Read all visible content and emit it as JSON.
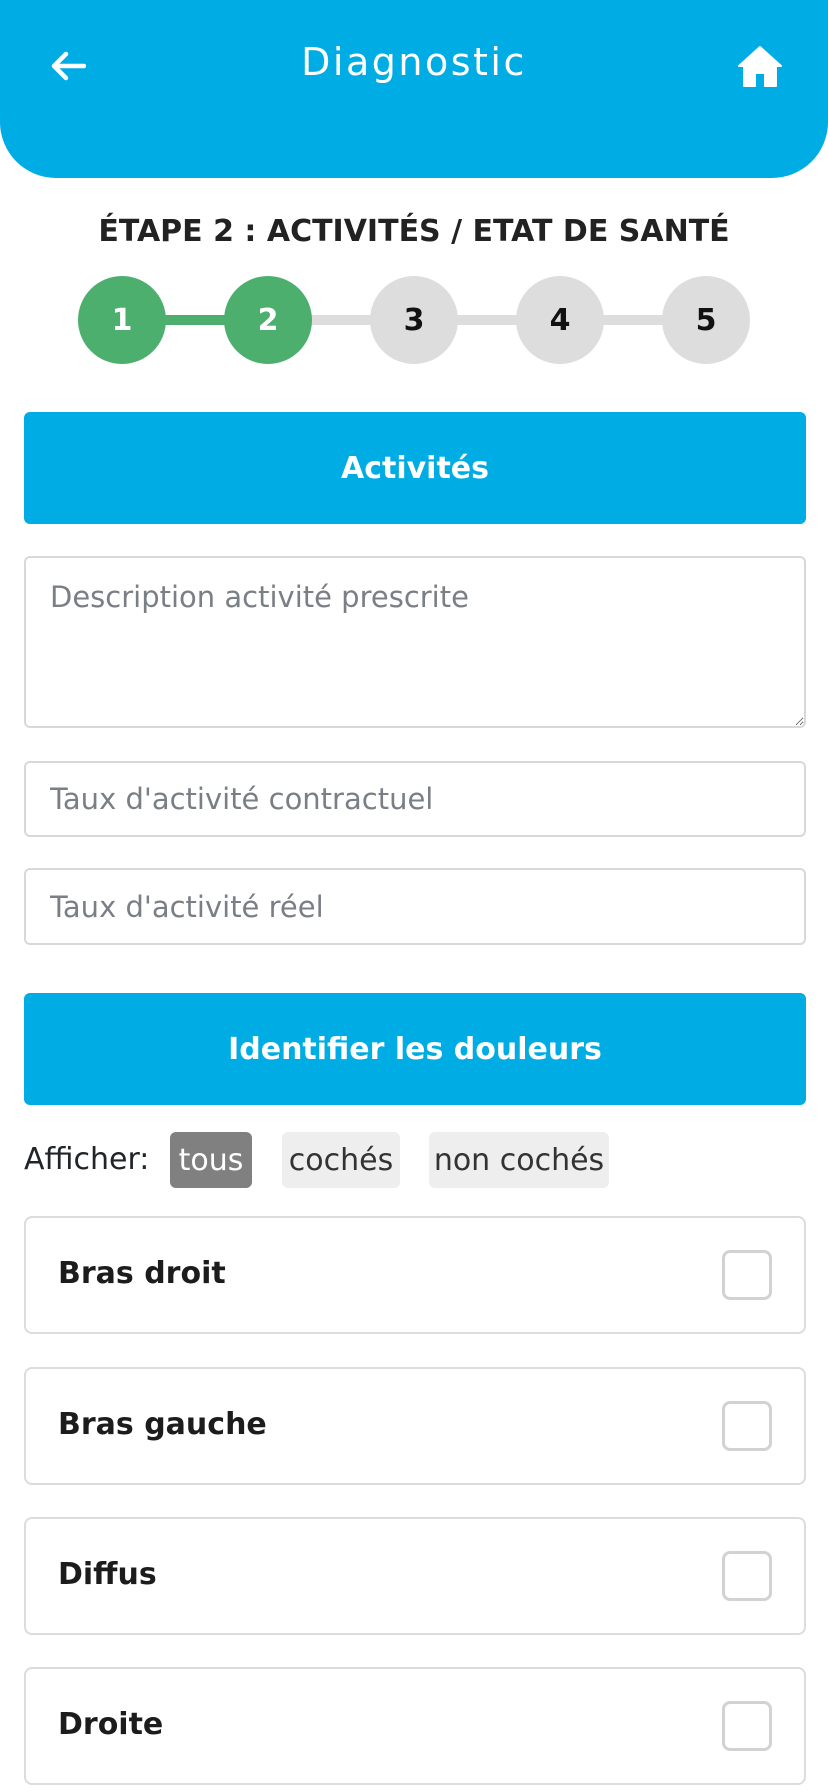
{
  "header": {
    "title": "Diagnostic",
    "back_icon": "arrow-left-icon",
    "home_icon": "home-icon",
    "color": "#00ace4"
  },
  "step": {
    "title": "ÉTAPE 2 : ACTIVITÉS / ETAT DE SANTÉ",
    "current": 2,
    "steps": [
      "1",
      "2",
      "3",
      "4",
      "5"
    ],
    "done_color": "#4caf6e",
    "todo_color": "#dddddd"
  },
  "activities": {
    "section_label": "Activités",
    "description_placeholder": "Description activité prescrite",
    "contract_rate_placeholder": "Taux d'activité contractuel",
    "real_rate_placeholder": "Taux d'activité réel"
  },
  "pain": {
    "section_label": "Identifier les douleurs",
    "filter_label": "Afficher:",
    "filters": [
      "tous",
      "cochés",
      "non cochés"
    ],
    "active_filter": "tous",
    "items": [
      {
        "label": "Bras droit",
        "checked": false
      },
      {
        "label": "Bras gauche",
        "checked": false
      },
      {
        "label": "Diffus",
        "checked": false
      },
      {
        "label": "Droite",
        "checked": false
      }
    ]
  }
}
